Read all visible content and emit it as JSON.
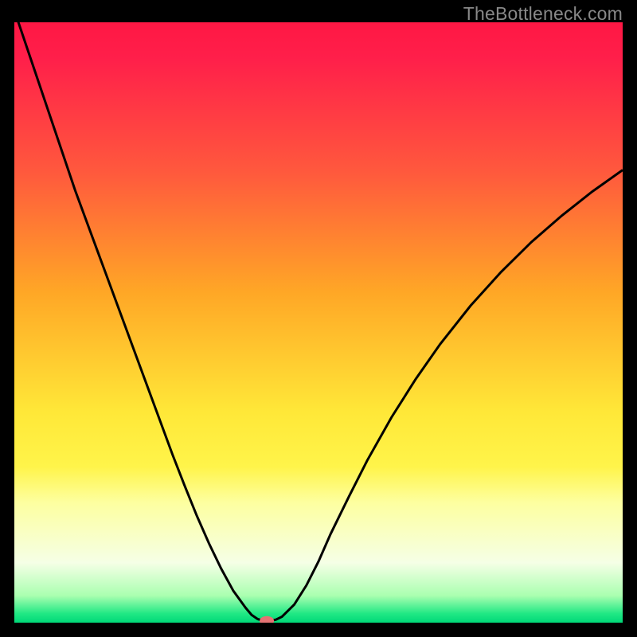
{
  "watermark": "TheBottleneck.com",
  "chart_data": {
    "type": "line",
    "title": "",
    "xlabel": "",
    "ylabel": "",
    "xlim": [
      0,
      100
    ],
    "ylim": [
      0,
      100
    ],
    "background_gradient": {
      "stops": [
        {
          "offset": 0.0,
          "color": "#ff1744"
        },
        {
          "offset": 0.06,
          "color": "#ff1f4a"
        },
        {
          "offset": 0.25,
          "color": "#ff593d"
        },
        {
          "offset": 0.45,
          "color": "#ffa726"
        },
        {
          "offset": 0.65,
          "color": "#ffe838"
        },
        {
          "offset": 0.74,
          "color": "#fff44a"
        },
        {
          "offset": 0.8,
          "color": "#fdffa0"
        },
        {
          "offset": 0.9,
          "color": "#f5ffe6"
        },
        {
          "offset": 0.955,
          "color": "#aaffb0"
        },
        {
          "offset": 0.985,
          "color": "#20e884"
        },
        {
          "offset": 1.0,
          "color": "#00d878"
        }
      ]
    },
    "series": [
      {
        "name": "bottleneck-curve",
        "type": "line",
        "color": "#000000",
        "width": 3.0,
        "x": [
          0,
          2,
          4,
          6,
          8,
          10,
          12,
          14,
          16,
          18,
          20,
          22,
          24,
          26,
          28,
          30,
          32,
          34,
          36,
          38,
          39,
          40,
          41,
          42,
          43,
          44,
          46,
          48,
          50,
          52,
          55,
          58,
          62,
          66,
          70,
          75,
          80,
          85,
          90,
          95,
          100
        ],
        "y": [
          102,
          96,
          90,
          84,
          78,
          72,
          66.5,
          61,
          55.5,
          50,
          44.5,
          39,
          33.5,
          28,
          22.8,
          17.8,
          13.2,
          9.0,
          5.3,
          2.5,
          1.3,
          0.6,
          0.3,
          0.3,
          0.5,
          1.0,
          3.0,
          6.2,
          10.2,
          14.8,
          21.0,
          27.0,
          34.2,
          40.6,
          46.4,
          52.8,
          58.4,
          63.4,
          67.8,
          71.8,
          75.4
        ]
      }
    ],
    "marker": {
      "name": "optimal-point",
      "x": 41.5,
      "y": 0.3,
      "color": "#e57373",
      "rx": 9,
      "ry": 6
    }
  }
}
